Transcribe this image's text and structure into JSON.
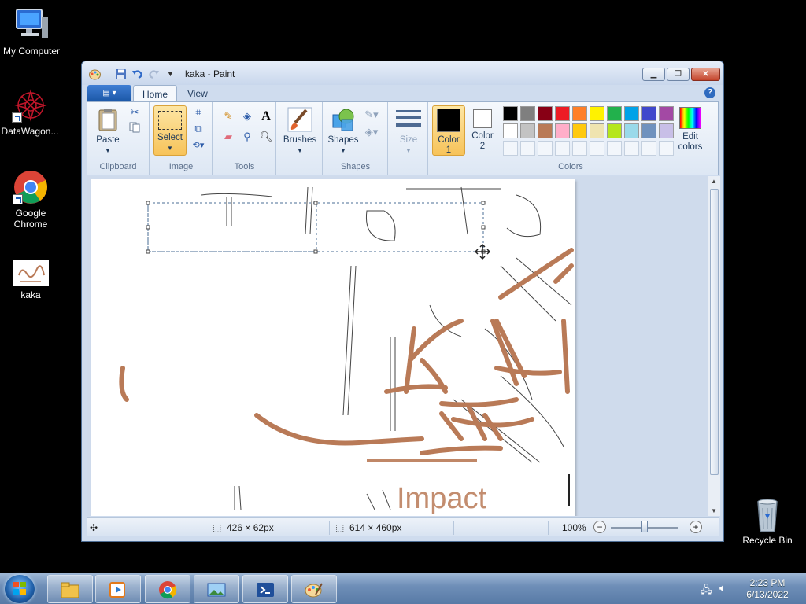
{
  "desktop": {
    "icons": [
      {
        "label": "My Computer",
        "icon": "computer-icon"
      },
      {
        "label": "DataWagon...",
        "icon": "datawagon-icon"
      },
      {
        "label": "Google Chrome",
        "icon": "chrome-icon"
      },
      {
        "label": "kaka",
        "icon": "image-file-icon"
      },
      {
        "label": "Recycle Bin",
        "icon": "recycle-bin-icon"
      }
    ]
  },
  "window": {
    "title": "kaka - Paint",
    "tabs": [
      "Home",
      "View"
    ],
    "help": "?",
    "active_tab": "Home"
  },
  "ribbon": {
    "clipboard": {
      "paste": "Paste",
      "label": "Clipboard"
    },
    "image": {
      "select": "Select",
      "label": "Image"
    },
    "tools": {
      "text_tool": "A",
      "label": "Tools"
    },
    "brushes": {
      "label": "Brushes"
    },
    "shapes": {
      "shapes": "Shapes",
      "label": "Shapes"
    },
    "size": {
      "label": "Size"
    },
    "colors": {
      "color1": "Color 1",
      "color2": "Color 2",
      "edit": "Edit colors",
      "label": "Colors",
      "color1_value": "#000000",
      "color2_value": "#ffffff",
      "palette_row1": [
        "#000000",
        "#7f7f7f",
        "#880015",
        "#ed1c24",
        "#ff7f27",
        "#fff200",
        "#22b14c",
        "#00a2e8",
        "#3f48cc",
        "#a349a4"
      ],
      "palette_row2": [
        "#ffffff",
        "#c3c3c3",
        "#b97a57",
        "#ffaec9",
        "#ffc90e",
        "#efe4b0",
        "#b5e61d",
        "#99d9ea",
        "#7092be",
        "#c8bfe7"
      ]
    }
  },
  "canvas": {
    "text_impact": "Impact",
    "sketch_letters": [
      "KA"
    ],
    "selection": "dashed-rectangle"
  },
  "status": {
    "selection_size": "426 × 62px",
    "image_size": "614 × 460px",
    "zoom": "100%",
    "zoom_level": 1.0
  },
  "taskbar": {
    "time": "2:23 PM",
    "date": "6/13/2022",
    "items": [
      "explorer-icon",
      "media-player-icon",
      "chrome-icon",
      "photo-viewer-icon",
      "powershell-icon",
      "paint-icon"
    ]
  }
}
